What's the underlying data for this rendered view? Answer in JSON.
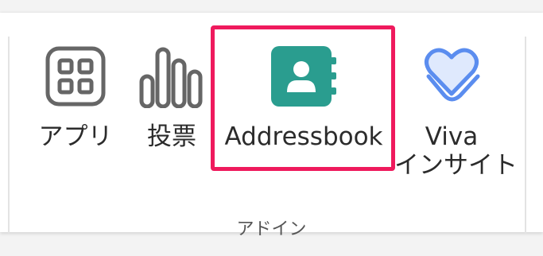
{
  "ribbon": {
    "group_label": "アドイン",
    "buttons": [
      {
        "label": "アプリ",
        "icon": "apps-grid-icon"
      },
      {
        "label": "投票",
        "icon": "poll-bars-icon"
      },
      {
        "label": "Addressbook",
        "icon": "addressbook-icon",
        "highlighted": true
      },
      {
        "label_line1": "Viva",
        "label_line2": "インサイト",
        "icon": "viva-insights-icon"
      }
    ]
  },
  "colors": {
    "highlight_border": "#ef1a5d",
    "addressbook_icon_bg": "#2a9d8f",
    "viva_icon_stroke": "#5b8def",
    "text": "#2b2b2b"
  }
}
